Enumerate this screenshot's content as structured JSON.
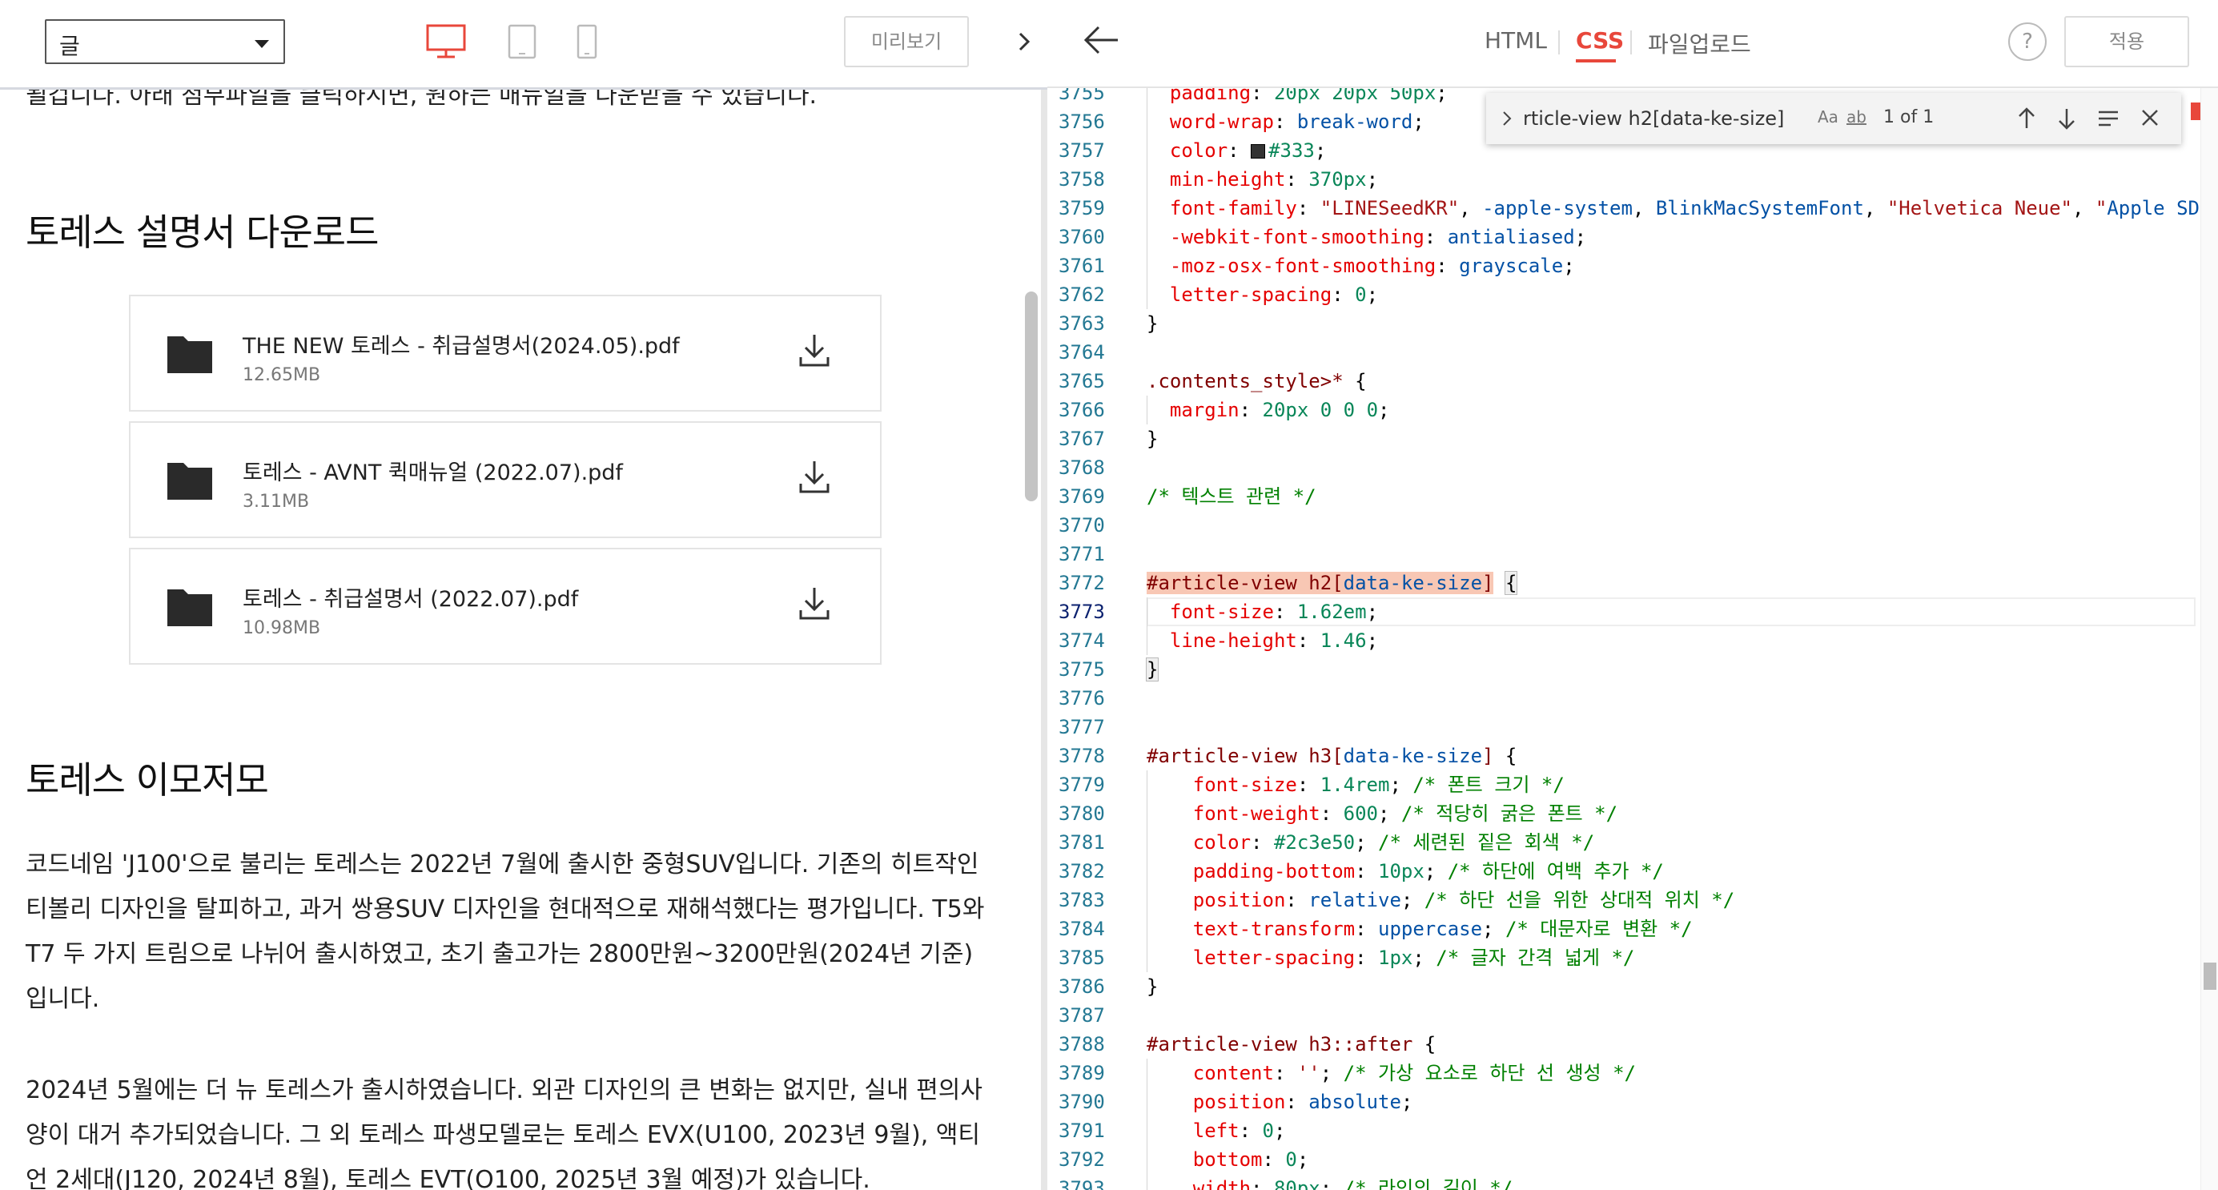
{
  "left_toolbar": {
    "category_value": "글",
    "preview_label": "미리보기",
    "device_icons": [
      "desktop-icon",
      "tablet-icon",
      "mobile-icon"
    ],
    "active_device_color": "#e8473b"
  },
  "article": {
    "clipped_text": "될겁니다. 아래 첨부파일을 클릭하시면, 원하는 매뉴얼을 다운받을 수 있습니다.",
    "section1_title": "토레스 설명서 다운로드",
    "files": [
      {
        "name": "THE NEW 토레스 - 취급설명서(2024.05).pdf",
        "size": "12.65MB"
      },
      {
        "name": "토레스 - AVNT 퀵매뉴얼 (2022.07).pdf",
        "size": "3.11MB"
      },
      {
        "name": "토레스 - 취급설명서 (2022.07).pdf",
        "size": "10.98MB"
      }
    ],
    "section2_title": "토레스 이모저모",
    "paragraph1": "코드네임 'J100'으로 불리는 토레스는 2022년 7월에 출시한 중형SUV입니다. 기존의 히트작인 티볼리 디자인을 탈피하고, 과거 쌍용SUV 디자인을 현대적으로 재해석했다는 평가입니다. T5와 T7 두 가지 트림으로 나뉘어 출시하였고, 초기 출고가는 2800만원~3200만원(2024년 기준)입니다.",
    "paragraph2": "2024년 5월에는 더 뉴 토레스가 출시하였습니다. 외관 디자인의 큰 변화는 없지만, 실내 편의사양이 대거 추가되었습니다. 그 외 토레스 파생모델로는 토레스 EVX(U100, 2023년 9월), 액티언 2세대(J120, 2024년 8월), 토레스 EVT(O100, 2025년 3월 예정)가 있습니다."
  },
  "right_toolbar": {
    "tabs": [
      {
        "label": "HTML",
        "active": false
      },
      {
        "label": "CSS",
        "active": true
      },
      {
        "label": "파일업로드",
        "active": false
      }
    ],
    "help_label": "?",
    "apply_label": "적용",
    "accent_color": "#e8473b"
  },
  "find_widget": {
    "query": "rticle-view h2[data-ke-size]",
    "option_case": "Aa",
    "option_word": "ab",
    "option_regex": ".*",
    "count": "1 of 1"
  },
  "editor": {
    "current_line": 3773,
    "lines": [
      {
        "n": "3755",
        "code": "  padding: 20px 20px 50px;"
      },
      {
        "n": "3756",
        "code": "  word-wrap: break-word;"
      },
      {
        "n": "3757",
        "code": "  color: #333;"
      },
      {
        "n": "3758",
        "code": "  min-height: 370px;"
      },
      {
        "n": "3759",
        "code": "  font-family: \"LINESeedKR\", -apple-system, BlinkMacSystemFont, \"Helvetica Neue\", \"Apple SD"
      },
      {
        "n": "3760",
        "code": "  -webkit-font-smoothing: antialiased;"
      },
      {
        "n": "3761",
        "code": "  -moz-osx-font-smoothing: grayscale;"
      },
      {
        "n": "3762",
        "code": "  letter-spacing: 0;"
      },
      {
        "n": "3763",
        "code": "}"
      },
      {
        "n": "3764",
        "code": ""
      },
      {
        "n": "3765",
        "code": ".contents_style>* {"
      },
      {
        "n": "3766",
        "code": "  margin: 20px 0 0 0;"
      },
      {
        "n": "3767",
        "code": "}"
      },
      {
        "n": "3768",
        "code": ""
      },
      {
        "n": "3769",
        "code": "/* 텍스트 관련 */"
      },
      {
        "n": "3770",
        "code": ""
      },
      {
        "n": "3771",
        "code": ""
      },
      {
        "n": "3772",
        "code": "#article-view h2[data-ke-size] {"
      },
      {
        "n": "3773",
        "code": "  font-size: 1.62em;"
      },
      {
        "n": "3774",
        "code": "  line-height: 1.46;"
      },
      {
        "n": "3775",
        "code": "}"
      },
      {
        "n": "3776",
        "code": ""
      },
      {
        "n": "3777",
        "code": ""
      },
      {
        "n": "3778",
        "code": "#article-view h3[data-ke-size] {"
      },
      {
        "n": "3779",
        "code": "    font-size: 1.4rem; /* 폰트 크기 */"
      },
      {
        "n": "3780",
        "code": "    font-weight: 600; /* 적당히 굵은 폰트 */"
      },
      {
        "n": "3781",
        "code": "    color: #2c3e50; /* 세련된 짙은 회색 */"
      },
      {
        "n": "3782",
        "code": "    padding-bottom: 10px; /* 하단에 여백 추가 */"
      },
      {
        "n": "3783",
        "code": "    position: relative; /* 하단 선을 위한 상대적 위치 */"
      },
      {
        "n": "3784",
        "code": "    text-transform: uppercase; /* 대문자로 변환 */"
      },
      {
        "n": "3785",
        "code": "    letter-spacing: 1px; /* 글자 간격 넓게 */"
      },
      {
        "n": "3786",
        "code": "}"
      },
      {
        "n": "3787",
        "code": ""
      },
      {
        "n": "3788",
        "code": "#article-view h3::after {"
      },
      {
        "n": "3789",
        "code": "    content: ''; /* 가상 요소로 하단 선 생성 */"
      },
      {
        "n": "3790",
        "code": "    position: absolute;"
      },
      {
        "n": "3791",
        "code": "    left: 0;"
      },
      {
        "n": "3792",
        "code": "    bottom: 0;"
      },
      {
        "n": "3793",
        "code": "    width: 80px; /* 라인의 길이 */"
      }
    ]
  }
}
